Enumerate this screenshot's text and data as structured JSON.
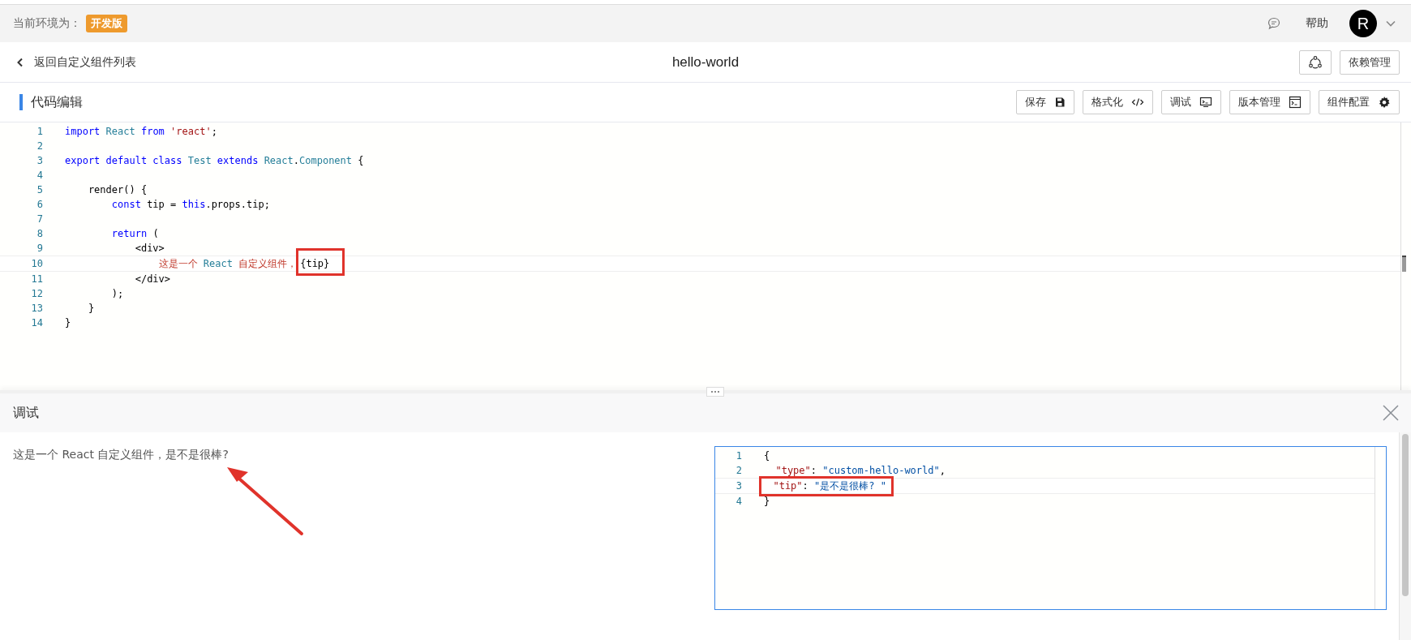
{
  "env": {
    "label": "当前环境为：",
    "badge": "开发版"
  },
  "header": {
    "help": "帮助",
    "avatar": "R"
  },
  "nav": {
    "back": "返回自定义组件列表",
    "title": "hello-world",
    "deps_button": "依赖管理"
  },
  "editor": {
    "title": "代码编辑",
    "buttons": [
      {
        "label": "保存",
        "kind": "save"
      },
      {
        "label": "格式化",
        "kind": "format"
      },
      {
        "label": "调试",
        "kind": "debug"
      },
      {
        "label": "版本管理",
        "kind": "version"
      },
      {
        "label": "组件配置",
        "kind": "settings"
      }
    ],
    "lines": [
      {
        "number": "1",
        "current": false,
        "tokens": [
          {
            "kind": "keyword",
            "text": "import"
          },
          {
            "kind": "type",
            "text": " React"
          },
          {
            "kind": "keyword",
            "text": " from"
          },
          {
            "kind": "string",
            "text": " 'react'"
          },
          {
            "kind": "plain",
            "text": ";"
          }
        ]
      },
      {
        "number": "2",
        "current": false
      },
      {
        "number": "3",
        "current": false,
        "tokens": [
          {
            "kind": "keyword",
            "text": "export default class"
          },
          {
            "kind": "type",
            "text": " Test"
          },
          {
            "kind": "keyword",
            "text": " extends"
          },
          {
            "kind": "type",
            "text": " React"
          },
          {
            "kind": "plain",
            "text": "."
          },
          {
            "kind": "type",
            "text": "Component"
          },
          {
            "kind": "plain",
            "text": " {"
          }
        ]
      },
      {
        "number": "4",
        "current": false
      },
      {
        "number": "5",
        "current": false,
        "tokens": [
          {
            "kind": "plain",
            "text": "    render() {"
          }
        ]
      },
      {
        "number": "6",
        "current": false,
        "tokens": [
          {
            "kind": "keyword",
            "text": "        const"
          },
          {
            "kind": "plain",
            "text": " tip = "
          },
          {
            "kind": "keyword",
            "text": "this"
          },
          {
            "kind": "plain",
            "text": ".props.tip;"
          }
        ]
      },
      {
        "number": "7",
        "current": false
      },
      {
        "number": "8",
        "current": false,
        "tokens": [
          {
            "kind": "keyword",
            "text": "        return"
          },
          {
            "kind": "plain",
            "text": " ("
          }
        ]
      },
      {
        "number": "9",
        "current": false,
        "tokens": [
          {
            "kind": "plain",
            "text": "            <div>"
          }
        ]
      },
      {
        "number": "10",
        "current": true,
        "tokens": [
          {
            "kind": "text",
            "text": "                这是一个"
          },
          {
            "kind": "type",
            "text": " React"
          },
          {
            "kind": "text",
            "text": " 自定义组件，"
          },
          {
            "kind": "expression",
            "text": "{tip}"
          }
        ]
      },
      {
        "number": "11",
        "current": false,
        "tokens": [
          {
            "kind": "plain",
            "text": "            </div>"
          }
        ]
      },
      {
        "number": "12",
        "current": false,
        "tokens": [
          {
            "kind": "plain",
            "text": "        );"
          }
        ]
      },
      {
        "number": "13",
        "current": false,
        "tokens": [
          {
            "kind": "plain",
            "text": "    }"
          }
        ]
      },
      {
        "number": "14",
        "current": false,
        "tokens": [
          {
            "kind": "plain",
            "text": "}"
          }
        ]
      }
    ]
  },
  "debug": {
    "title": "调试",
    "output": "这是一个 React 自定义组件，是不是很棒?",
    "lines": [
      {
        "number": "1",
        "current": false,
        "tokens": [
          {
            "kind": "plain",
            "text": "{"
          }
        ]
      },
      {
        "number": "2",
        "current": false,
        "tokens": [
          {
            "kind": "key",
            "text": "  \"type\""
          },
          {
            "kind": "plain",
            "text": ": "
          },
          {
            "kind": "value",
            "text": "\"custom-hello-world\""
          },
          {
            "kind": "plain",
            "text": ","
          }
        ]
      },
      {
        "number": "3",
        "current": true,
        "tokens": [
          {
            "kind": "key",
            "text": "  \"tip\""
          },
          {
            "kind": "plain",
            "text": ": "
          },
          {
            "kind": "value",
            "text": "\"是不是很棒? \""
          }
        ]
      },
      {
        "number": "4",
        "current": false,
        "tokens": [
          {
            "kind": "plain",
            "text": "}"
          }
        ]
      }
    ]
  }
}
